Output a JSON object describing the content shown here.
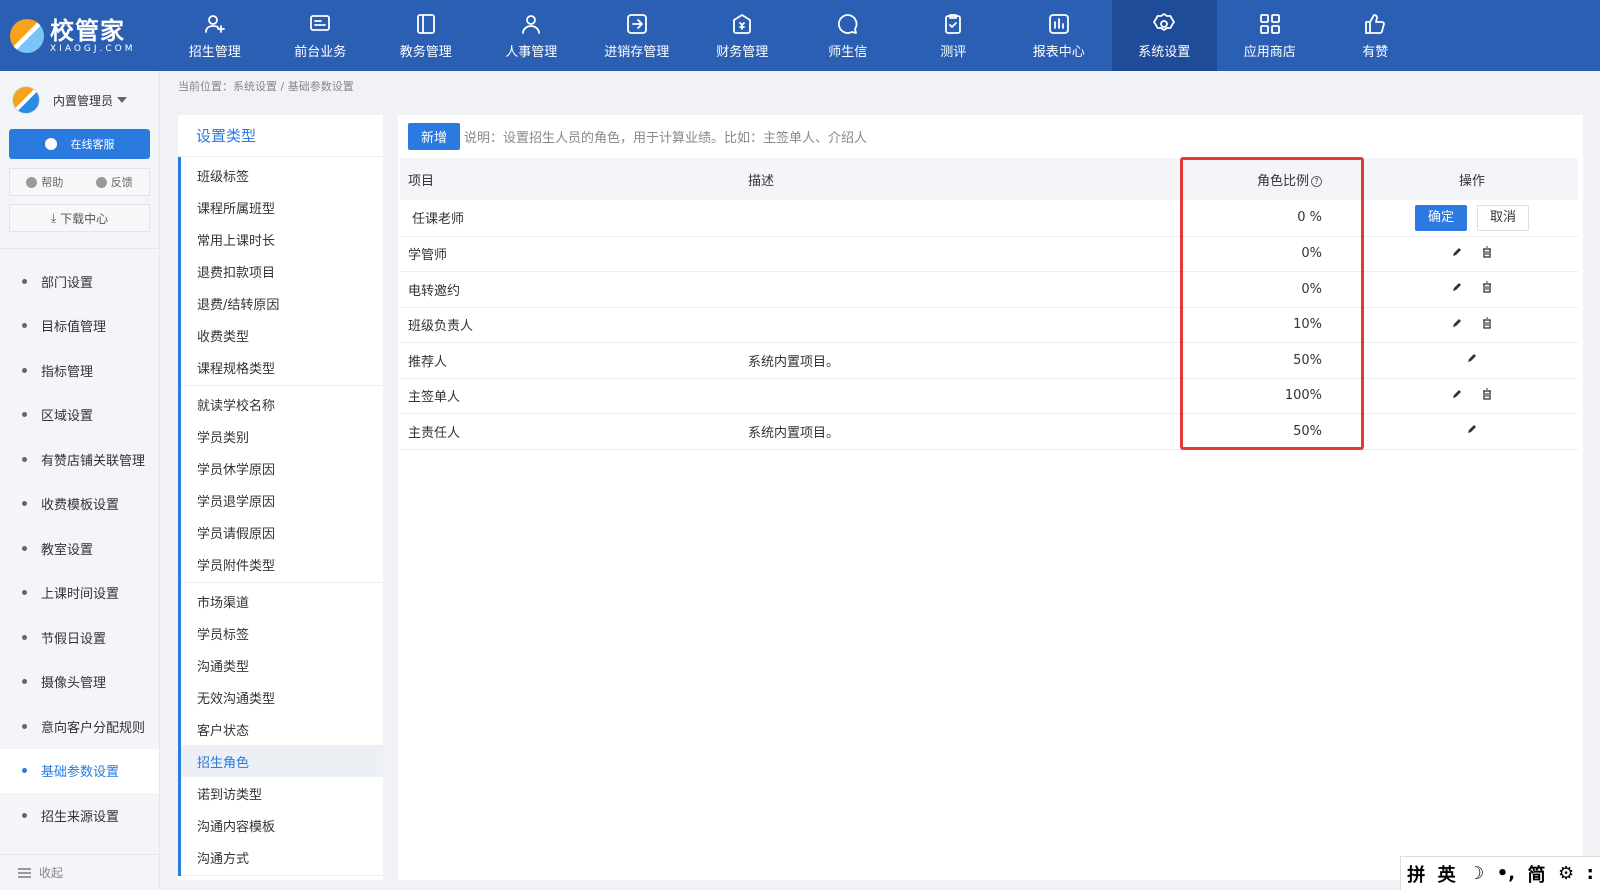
{
  "logo": {
    "name": "校管家",
    "sub": "XIAOGJ.COM"
  },
  "nav": [
    {
      "label": "招生管理",
      "icon": "user-add-icon"
    },
    {
      "label": "前台业务",
      "icon": "screen-icon"
    },
    {
      "label": "教务管理",
      "icon": "book-icon"
    },
    {
      "label": "人事管理",
      "icon": "person-icon"
    },
    {
      "label": "进销存管理",
      "icon": "login-box-icon"
    },
    {
      "label": "财务管理",
      "icon": "money-house-icon"
    },
    {
      "label": "师生信",
      "icon": "chat-icon"
    },
    {
      "label": "测评",
      "icon": "clipboard-check-icon"
    },
    {
      "label": "报表中心",
      "icon": "chart-box-icon"
    },
    {
      "label": "系统设置",
      "icon": "gear-icon",
      "active": true
    },
    {
      "label": "应用商店",
      "icon": "grid-icon"
    },
    {
      "label": "有赞",
      "icon": "thumbs-up-icon"
    }
  ],
  "sidebar": {
    "user": "内置管理员",
    "service": "在线客服",
    "help": "帮助",
    "feedback": "反馈",
    "download": "下载中心",
    "items": [
      {
        "label": "部门设置"
      },
      {
        "label": "目标值管理"
      },
      {
        "label": "指标管理"
      },
      {
        "label": "区域设置"
      },
      {
        "label": "有赞店铺关联管理"
      },
      {
        "label": "收费模板设置"
      },
      {
        "label": "教室设置"
      },
      {
        "label": "上课时间设置"
      },
      {
        "label": "节假日设置"
      },
      {
        "label": "摄像头管理"
      },
      {
        "label": "意向客户分配规则"
      },
      {
        "label": "基础参数设置",
        "active": true
      },
      {
        "label": "招生来源设置"
      }
    ],
    "collapse": "收起"
  },
  "breadcrumb": "当前位置：系统设置 / 基础参数设置",
  "settings": {
    "title": "设置类型",
    "groups": [
      [
        "班级标签",
        "课程所属班型",
        "常用上课时长",
        "退费扣款项目",
        "退费/结转原因",
        "收费类型",
        "课程规格类型"
      ],
      [
        "就读学校名称",
        "学员类别",
        "学员休学原因",
        "学员退学原因",
        "学员请假原因",
        "学员附件类型"
      ],
      [
        "市场渠道",
        "学员标签",
        "沟通类型",
        "无效沟通类型",
        "客户状态",
        "招生角色",
        "诺到访类型",
        "沟通内容模板",
        "沟通方式"
      ]
    ],
    "active": "招生角色"
  },
  "content": {
    "add_label": "新增",
    "description": "说明：设置招生人员的角色，用于计算业绩。比如：主签单人、介绍人",
    "columns": {
      "item": "项目",
      "desc": "描述",
      "ratio": "角色比例",
      "ratio_help": "?",
      "op": "操作"
    },
    "edit_row": {
      "item": "任课老师",
      "ratio": "0 %",
      "ok": "确定",
      "cancel": "取消"
    },
    "rows": [
      {
        "item": "学管师",
        "desc": "",
        "ratio": "0%",
        "deletable": true
      },
      {
        "item": "电转邀约",
        "desc": "",
        "ratio": "0%",
        "deletable": true
      },
      {
        "item": "班级负责人",
        "desc": "",
        "ratio": "10%",
        "deletable": true
      },
      {
        "item": "推荐人",
        "desc": "系统内置项目。",
        "ratio": "50%",
        "deletable": false
      },
      {
        "item": "主签单人",
        "desc": "",
        "ratio": "100%",
        "deletable": true
      },
      {
        "item": "主责任人",
        "desc": "系统内置项目。",
        "ratio": "50%",
        "deletable": false
      }
    ]
  },
  "ime": [
    "拼",
    "英",
    "☽",
    "•,",
    "简",
    "⚙",
    ":"
  ]
}
